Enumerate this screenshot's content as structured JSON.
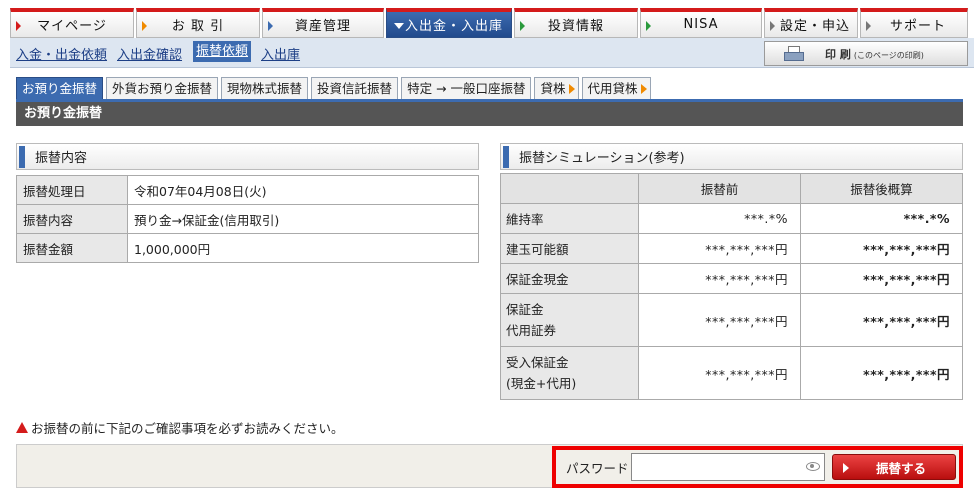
{
  "nav": {
    "tabs": [
      {
        "label": "マイページ",
        "tri": "#d41b1b"
      },
      {
        "label": "お 取 引",
        "tri": "#f08a00"
      },
      {
        "label": "資産管理",
        "tri": "#3c6bb0"
      },
      {
        "label": "入出金・入出庫",
        "tri": "#ffffff"
      },
      {
        "label": "投資情報",
        "tri": "#2a9a3c"
      },
      {
        "label": "NISA",
        "tri": "#2a9a3c"
      },
      {
        "label": "設定・申込",
        "tri": "#777777"
      },
      {
        "label": "サポート",
        "tri": "#777777"
      }
    ]
  },
  "subnav": {
    "links": [
      "入金・出金依頼",
      "入出金確認",
      "振替依頼",
      "入出庫"
    ],
    "print_label": "印 刷",
    "print_sub": "(このページの印刷)"
  },
  "tabs": [
    "お預り金振替",
    "外貨お預り金振替",
    "現物株式振替",
    "投資信託振替",
    "特定 → 一般口座振替",
    "貸株",
    "代用貸株"
  ],
  "page_title": "お預り金振替",
  "left": {
    "heading": "振替内容",
    "rows": [
      {
        "label": "振替処理日",
        "value": "令和07年04月08日(火)"
      },
      {
        "label": "振替内容",
        "value": "預り金→保証金(信用取引)"
      },
      {
        "label": "振替金額",
        "value": "1,000,000円"
      }
    ]
  },
  "right": {
    "heading": "振替シミュレーション(参考)",
    "col_before": "振替前",
    "col_after": "振替後概算",
    "rows": [
      {
        "label": "維持率",
        "label2": "",
        "before": "***.*%",
        "after": "***.*%"
      },
      {
        "label": "建玉可能額",
        "label2": "",
        "before": "***,***,***円",
        "after": "***,***,***円"
      },
      {
        "label": "保証金現金",
        "label2": "",
        "before": "***,***,***円",
        "after": "***,***,***円"
      },
      {
        "label": "保証金",
        "label2": "代用証券",
        "before": "***,***,***円",
        "after": "***,***,***円"
      },
      {
        "label": "受入保証金",
        "label2": "(現金+代用)",
        "before": "***,***,***円",
        "after": "***,***,***円"
      }
    ]
  },
  "warning": "お振替の前に下記のご確認事項を必ずお読みください。",
  "password_label": "パスワード",
  "password_value": "",
  "submit_label": "振替する",
  "colors": {
    "accent": "#3c6bb0",
    "brand_red": "#d41b1b"
  }
}
